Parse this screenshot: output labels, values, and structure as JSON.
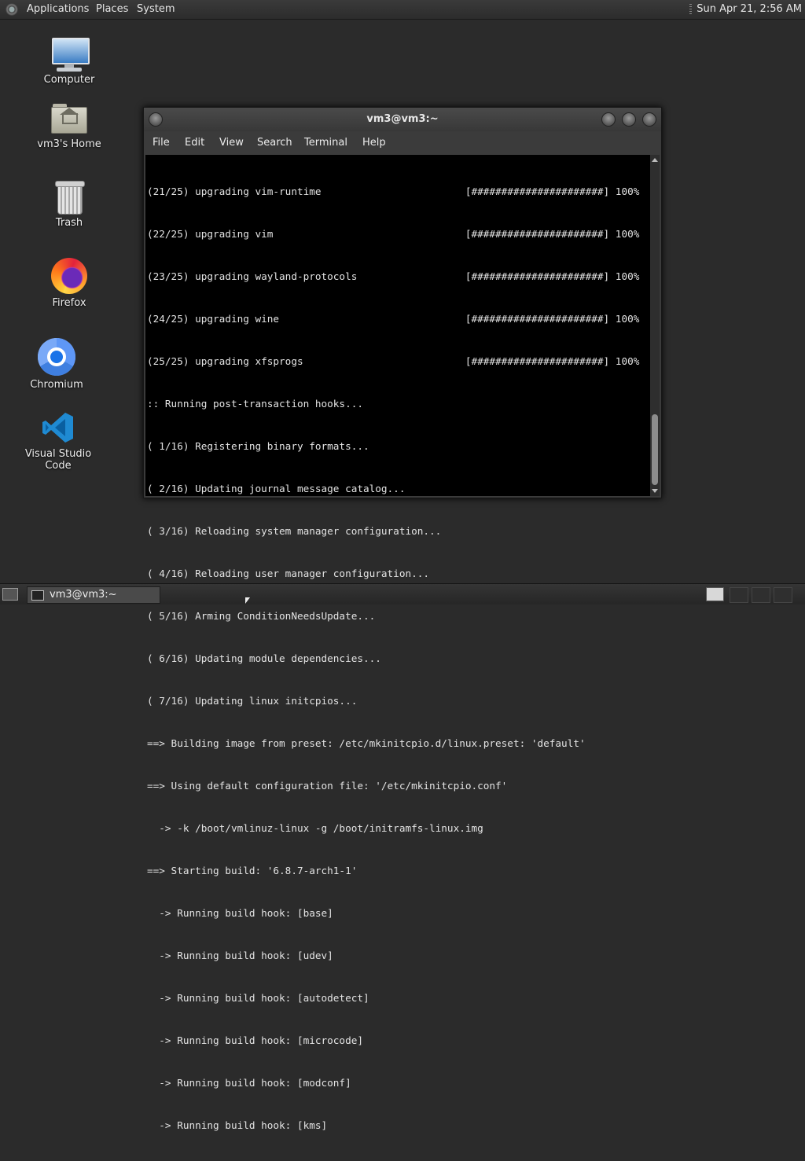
{
  "top_panel": {
    "menus": [
      "Applications",
      "Places",
      "System"
    ],
    "clock": "Sun Apr 21,  2:56 AM"
  },
  "desktop_icons": [
    {
      "label": "Computer",
      "icon": "computer-icon"
    },
    {
      "label": "vm3's Home",
      "icon": "home-folder-icon"
    },
    {
      "label": "Trash",
      "icon": "trash-icon"
    },
    {
      "label": "Firefox",
      "icon": "firefox-icon"
    },
    {
      "label": "Chromium",
      "icon": "chromium-icon"
    },
    {
      "label": "Visual Studio Code",
      "icon": "vscode-icon"
    }
  ],
  "terminal": {
    "title": "vm3@vm3:~",
    "menus": [
      "File",
      "Edit",
      "View",
      "Search",
      "Terminal",
      "Help"
    ],
    "lines": [
      "(21/25) upgrading vim-runtime                        [######################] 100%",
      "(22/25) upgrading vim                                [######################] 100%",
      "(23/25) upgrading wayland-protocols                  [######################] 100%",
      "(24/25) upgrading wine                               [######################] 100%",
      "(25/25) upgrading xfsprogs                           [######################] 100%",
      ":: Running post-transaction hooks...",
      "( 1/16) Registering binary formats...",
      "( 2/16) Updating journal message catalog...",
      "( 3/16) Reloading system manager configuration...",
      "( 4/16) Reloading user manager configuration...",
      "( 5/16) Arming ConditionNeedsUpdate...",
      "( 6/16) Updating module dependencies...",
      "( 7/16) Updating linux initcpios...",
      "==> Building image from preset: /etc/mkinitcpio.d/linux.preset: 'default'",
      "==> Using default configuration file: '/etc/mkinitcpio.conf'",
      "  -> -k /boot/vmlinuz-linux -g /boot/initramfs-linux.img",
      "==> Starting build: '6.8.7-arch1-1'",
      "  -> Running build hook: [base]",
      "  -> Running build hook: [udev]",
      "  -> Running build hook: [autodetect]",
      "  -> Running build hook: [microcode]",
      "  -> Running build hook: [modconf]",
      "  -> Running build hook: [kms]"
    ]
  },
  "bottom_panel": {
    "task_title": "vm3@vm3:~"
  }
}
